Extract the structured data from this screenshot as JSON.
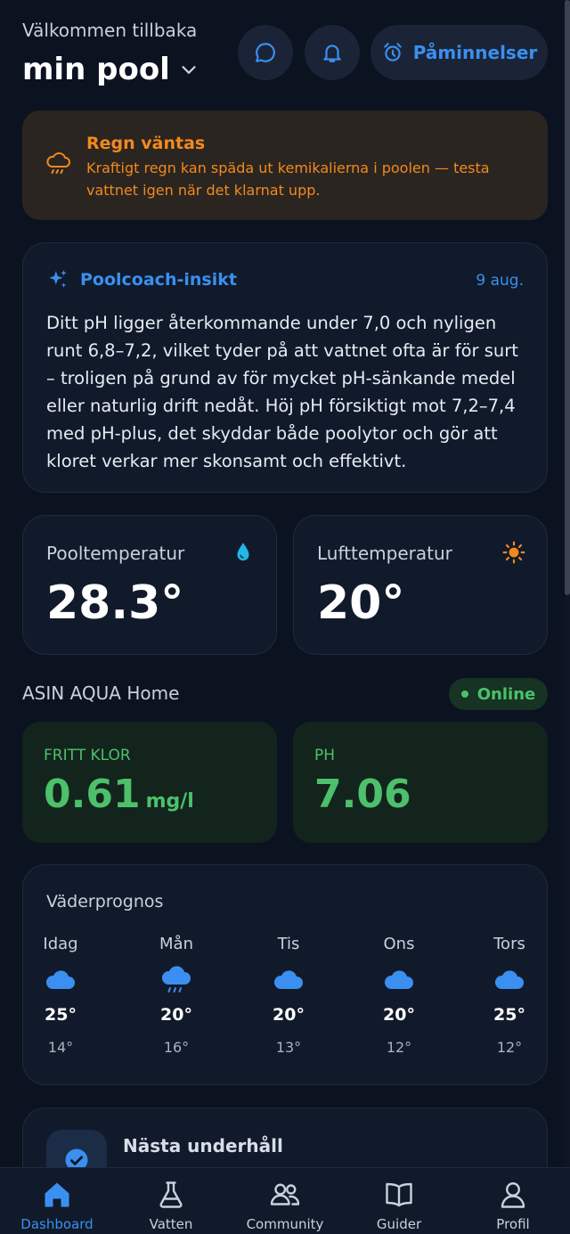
{
  "header": {
    "greeting": "Välkommen tillbaka",
    "pool_name": "min pool",
    "reminders_label": "Påminnelser"
  },
  "alert": {
    "title": "Regn väntas",
    "text": "Kraftigt regn kan späda ut kemikalierna i poolen — testa vattnet igen när det klarnat upp.",
    "color": "#f2891e"
  },
  "coach": {
    "title": "Poolcoach-insikt",
    "date": "9 aug.",
    "text": "Ditt pH ligger återkommande under 7,0 och nyligen runt 6,8–7,2, vilket tyder på att vattnet ofta är för surt – troligen på grund av för mycket pH-sänkande medel eller naturlig drift nedåt. Höj pH försiktigt mot 7,2–7,4 med pH-plus, det skyddar både poolytor och gör att kloret verkar mer skonsamt och effektivt."
  },
  "temps": {
    "pool_label": "Pooltemperatur",
    "pool_value": "28.3°",
    "air_label": "Lufttemperatur",
    "air_value": "20°"
  },
  "device": {
    "name": "ASIN AQUA Home",
    "status": "Online"
  },
  "metrics": {
    "klor_label": "FRITT KLOR",
    "klor_value": "0.61",
    "klor_unit": "mg/l",
    "ph_label": "PH",
    "ph_value": "7.06"
  },
  "weather": {
    "title": "Väderprognos",
    "days": [
      {
        "name": "Idag",
        "icon": "cloud-icon",
        "hi": "25°",
        "lo": "14°"
      },
      {
        "name": "Mån",
        "icon": "rain-cloud-icon",
        "hi": "20°",
        "lo": "16°"
      },
      {
        "name": "Tis",
        "icon": "cloud-icon",
        "hi": "20°",
        "lo": "13°"
      },
      {
        "name": "Ons",
        "icon": "cloud-icon",
        "hi": "20°",
        "lo": "12°"
      },
      {
        "name": "Tors",
        "icon": "cloud-icon",
        "hi": "25°",
        "lo": "12°"
      }
    ]
  },
  "maintenance": {
    "title": "Nästa underhåll"
  },
  "nav": {
    "items": [
      {
        "label": "Dashboard",
        "icon": "home-icon"
      },
      {
        "label": "Vatten",
        "icon": "flask-icon"
      },
      {
        "label": "Community",
        "icon": "users-icon"
      },
      {
        "label": "Guider",
        "icon": "book-icon"
      },
      {
        "label": "Profil",
        "icon": "user-icon"
      }
    ]
  },
  "colors": {
    "background": "#0b1220",
    "accent": "#3b8ff0",
    "success": "#4cc06b",
    "warning": "#f2891e"
  }
}
